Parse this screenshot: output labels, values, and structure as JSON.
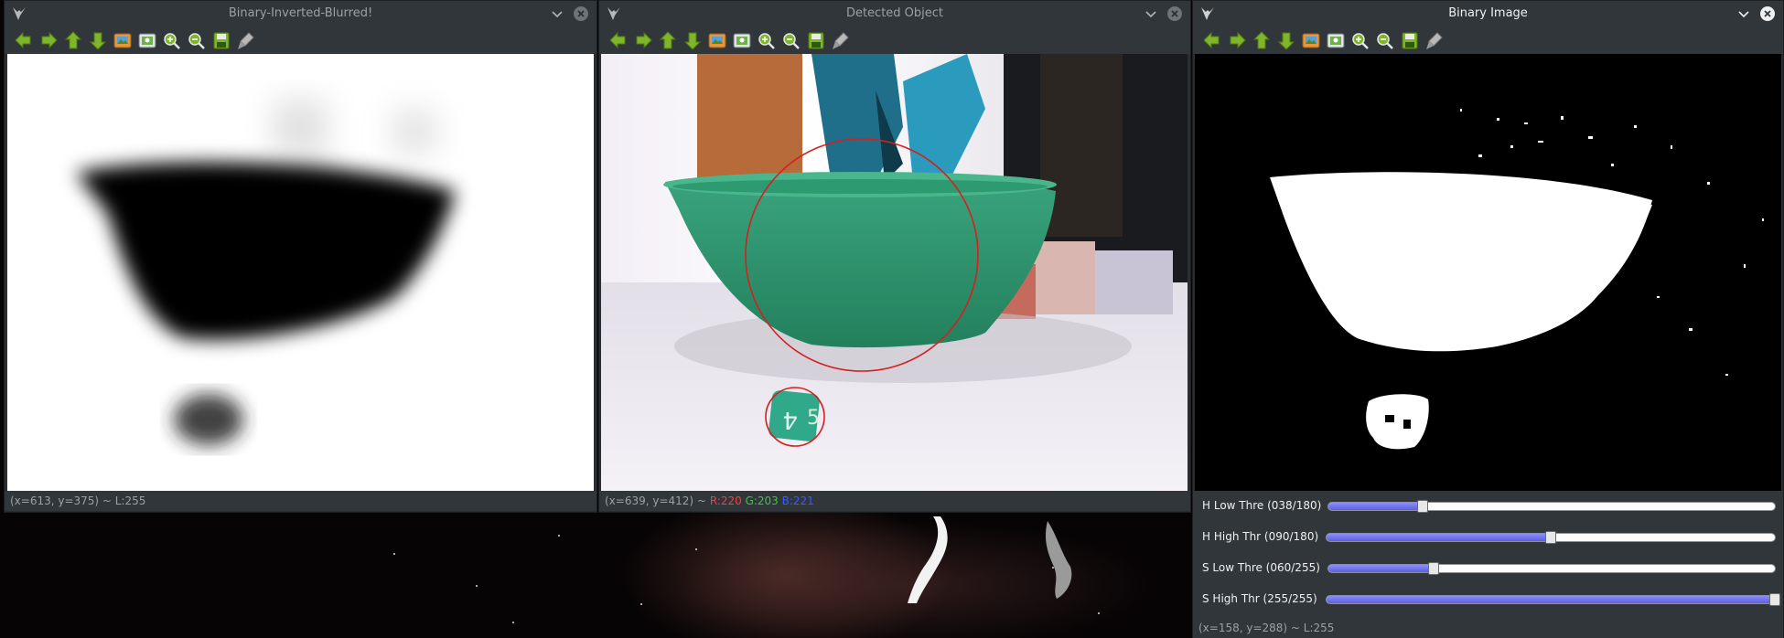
{
  "windows": [
    {
      "title": "Binary-Inverted-Blurred!",
      "status": "(x=613, y=375) ~ L:255",
      "active": false
    },
    {
      "title": "Detected Object",
      "status_coords": "(x=639, y=412) ~",
      "status_r": "R:220",
      "status_g": "G:203",
      "status_b": "B:221",
      "active": false
    },
    {
      "title": "Binary Image",
      "status": "(x=158, y=288) ~ L:255",
      "active": true
    }
  ],
  "toolbar_icons": [
    "arrow-left-icon",
    "arrow-right-icon",
    "arrow-up-icon",
    "arrow-down-icon",
    "image-icon",
    "screenshot-icon",
    "zoom-in-icon",
    "zoom-out-icon",
    "save-icon",
    "properties-icon"
  ],
  "trackbars": [
    {
      "label": "H Low Thre (038/180)",
      "value": 38,
      "max": 180
    },
    {
      "label": "H High Thr (090/180)",
      "value": 90,
      "max": 180
    },
    {
      "label": "S Low Thre (060/255)",
      "value": 60,
      "max": 255
    },
    {
      "label": "S High Thr (255/255)",
      "value": 255,
      "max": 255
    }
  ],
  "colors": {
    "accent": "#6a6cf0",
    "status_r": "#ff3b3b",
    "status_g": "#3fc43f",
    "status_b": "#3b5bff",
    "bowl": "#2f9b72",
    "circle": "#d61f1f"
  }
}
